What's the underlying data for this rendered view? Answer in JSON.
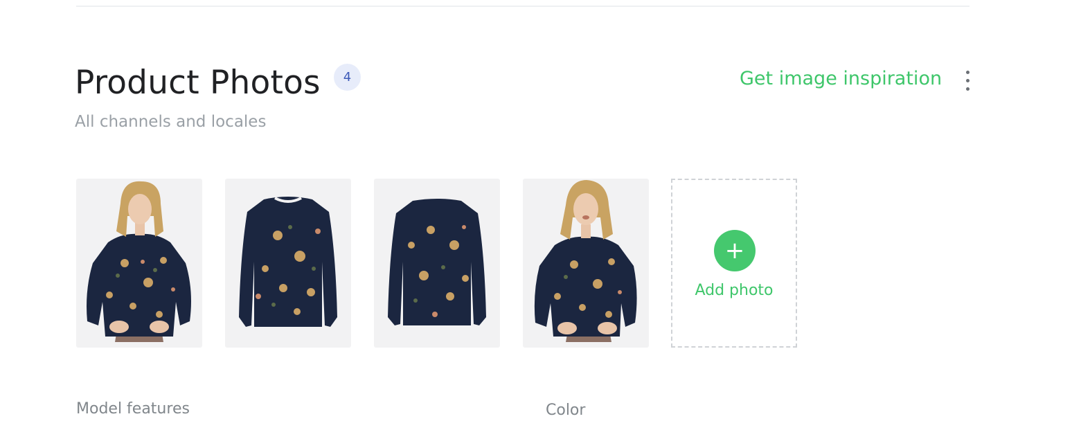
{
  "section": {
    "title": "Product Photos",
    "count": "4",
    "subtitle": "All channels and locales",
    "inspiration_link": "Get image inspiration",
    "menu_icon": "kebab-menu-icon"
  },
  "photos": [
    {
      "name": "model-front-photo"
    },
    {
      "name": "sweater-front-photo"
    },
    {
      "name": "sweater-back-photo"
    },
    {
      "name": "model-smiling-photo"
    }
  ],
  "add_photo": {
    "icon": "plus-icon",
    "label": "Add photo"
  },
  "fields": {
    "model_features_label": "Model features",
    "color_label": "Color"
  },
  "colors": {
    "accent_green": "#45c86e",
    "badge_bg": "#e7ecfa",
    "badge_text": "#3d5ab8",
    "sweater_navy": "#1b2640",
    "thumb_bg": "#f2f2f3"
  }
}
